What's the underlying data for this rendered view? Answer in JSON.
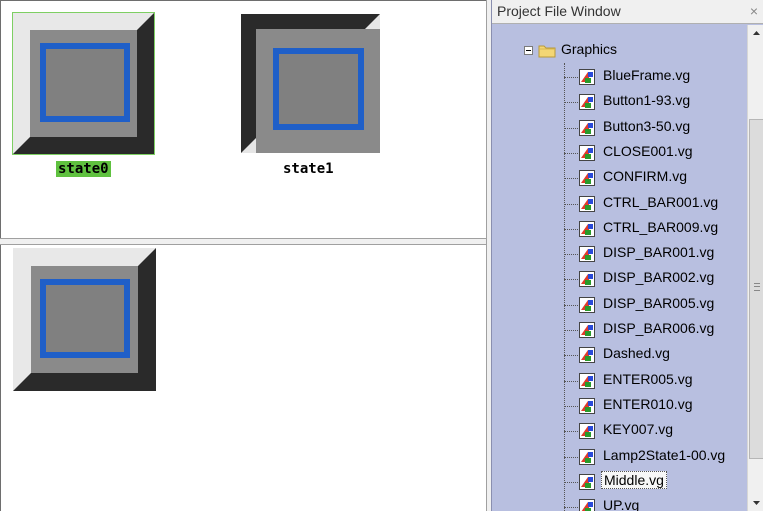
{
  "states": [
    {
      "label": "state0",
      "selected": true
    },
    {
      "label": "state1",
      "selected": false
    }
  ],
  "project_window": {
    "title": "Project File Window",
    "close": "×",
    "folder": {
      "label": "Graphics",
      "expanded": true
    },
    "files": [
      "BlueFrame.vg",
      "Button1-93.vg",
      "Button3-50.vg",
      "CLOSE001.vg",
      "CONFIRM.vg",
      "CTRL_BAR001.vg",
      "CTRL_BAR009.vg",
      "DISP_BAR001.vg",
      "DISP_BAR002.vg",
      "DISP_BAR005.vg",
      "DISP_BAR006.vg",
      "Dashed.vg",
      "ENTER005.vg",
      "ENTER010.vg",
      "KEY007.vg",
      "Lamp2State1-00.vg",
      "Middle.vg",
      "UP.vg"
    ],
    "selected_file": "Middle.vg"
  },
  "icons": {
    "folder": "folder-icon",
    "file": "vg-file-icon",
    "expander": "collapse-minus-icon"
  },
  "colors": {
    "selected_state_highlight": "#5fc13f",
    "panel_background": "#b8bfe0",
    "frame_blue": "#1f5fc8"
  }
}
